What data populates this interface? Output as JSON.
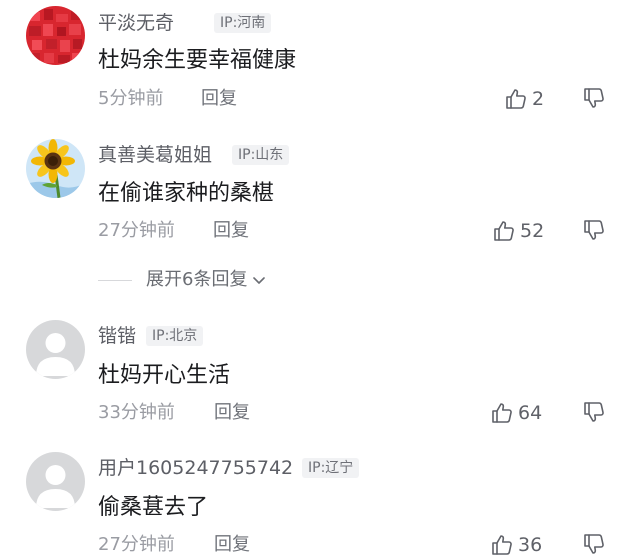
{
  "comments": [
    {
      "username": "平淡无奇",
      "ip": "IP:河南",
      "content": "杜妈余生要幸福健康",
      "time": "5分钟前",
      "reply_label": "回复",
      "likes": "2",
      "avatar": "red-texture"
    },
    {
      "username": "真善美葛姐姐",
      "ip": "IP:山东",
      "content": "在偷谁家种的桑椹",
      "time": "27分钟前",
      "reply_label": "回复",
      "likes": "52",
      "avatar": "sunflower"
    },
    {
      "username": "锴锴",
      "ip": "IP:北京",
      "content": "杜妈开心生活",
      "time": "33分钟前",
      "reply_label": "回复",
      "likes": "64",
      "avatar": "default-user"
    },
    {
      "username": "用户1605247755742",
      "ip": "IP:辽宁",
      "content": "偷桑葚去了",
      "time": "27分钟前",
      "reply_label": "回复",
      "likes": "36",
      "avatar": "default-user"
    }
  ],
  "expand_replies": {
    "label": "展开6条回复"
  },
  "icons": {
    "like": "thumbs-up-icon",
    "dislike": "thumbs-down-icon",
    "expand": "chevron-down-icon"
  },
  "colors": {
    "username": "#5d5f66",
    "content": "#1b1c1f",
    "meta": "#9a9ca3",
    "badge_bg": "#f1f2f4"
  }
}
